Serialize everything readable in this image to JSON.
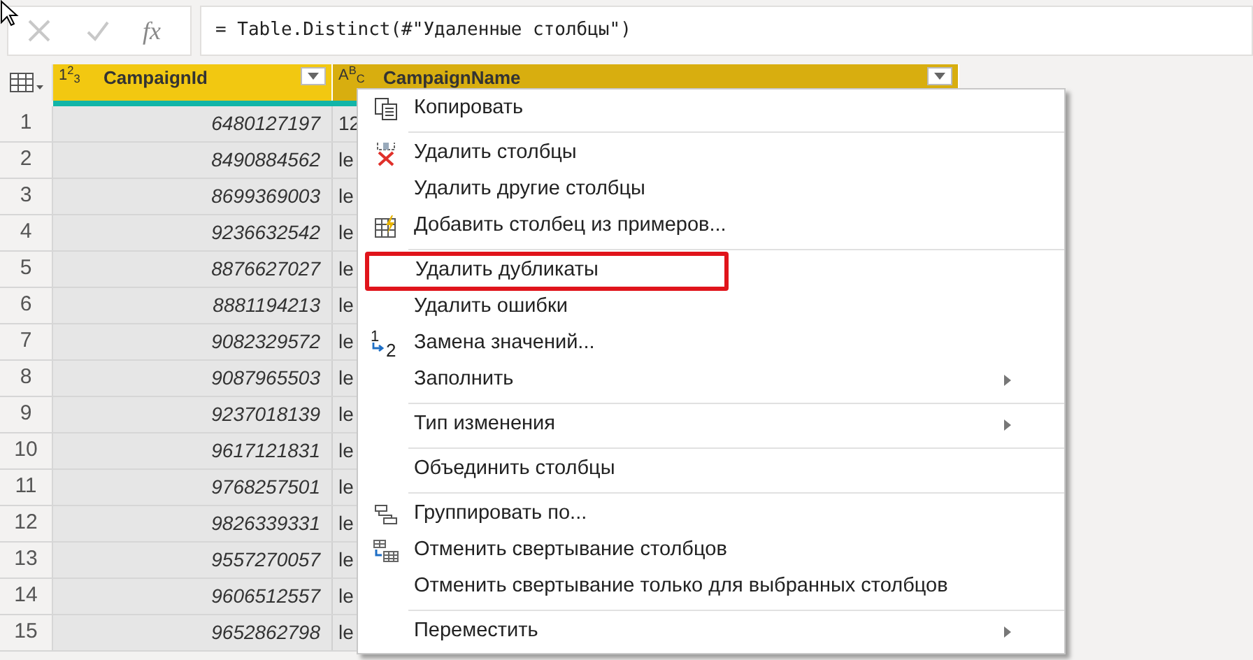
{
  "formula_bar": {
    "fx": "fx",
    "formula": "= Table.Distinct(#\"Удаленные столбцы\")"
  },
  "table": {
    "columns": [
      {
        "type_label": "1$^{2}$$_{3}$",
        "name": "CampaignId",
        "selected": false
      },
      {
        "type_label": "A$^{B}$$_{C}$",
        "name": "CampaignName",
        "selected": true
      }
    ],
    "rows": [
      {
        "n": "1",
        "id": "6480127197",
        "name": "12"
      },
      {
        "n": "2",
        "id": "8490884562",
        "name": "le"
      },
      {
        "n": "3",
        "id": "8699369003",
        "name": "le"
      },
      {
        "n": "4",
        "id": "9236632542",
        "name": "le"
      },
      {
        "n": "5",
        "id": "8876627027",
        "name": "le"
      },
      {
        "n": "6",
        "id": "8881194213",
        "name": "le"
      },
      {
        "n": "7",
        "id": "9082329572",
        "name": "le"
      },
      {
        "n": "8",
        "id": "9087965503",
        "name": "le"
      },
      {
        "n": "9",
        "id": "9237018139",
        "name": "le"
      },
      {
        "n": "10",
        "id": "9617121831",
        "name": "le"
      },
      {
        "n": "11",
        "id": "9768257501",
        "name": "le"
      },
      {
        "n": "12",
        "id": "9826339331",
        "name": "le"
      },
      {
        "n": "13",
        "id": "9557270057",
        "name": "le"
      },
      {
        "n": "14",
        "id": "9606512557",
        "name": "le"
      },
      {
        "n": "15",
        "id": "9652862798",
        "name": "le"
      }
    ]
  },
  "context_menu": {
    "items": [
      {
        "kind": "item",
        "label": "Копировать",
        "submenu": false,
        "highlighted": false
      },
      {
        "kind": "separator"
      },
      {
        "kind": "item",
        "label": "Удалить столбцы",
        "submenu": false,
        "highlighted": false
      },
      {
        "kind": "item",
        "label": "Удалить другие столбцы",
        "submenu": false,
        "highlighted": false
      },
      {
        "kind": "item",
        "label": "Добавить столбец из примеров...",
        "submenu": false,
        "highlighted": false
      },
      {
        "kind": "separator"
      },
      {
        "kind": "item",
        "label": "Удалить дубликаты",
        "submenu": false,
        "highlighted": true
      },
      {
        "kind": "item",
        "label": "Удалить ошибки",
        "submenu": false,
        "highlighted": false
      },
      {
        "kind": "item",
        "label": "Замена значений...",
        "icon_digits": [
          "1",
          "2"
        ],
        "submenu": false,
        "highlighted": false
      },
      {
        "kind": "item",
        "label": "Заполнить",
        "submenu": true,
        "highlighted": false
      },
      {
        "kind": "separator"
      },
      {
        "kind": "item",
        "label": "Тип изменения",
        "submenu": true,
        "highlighted": false
      },
      {
        "kind": "separator"
      },
      {
        "kind": "item",
        "label": "Объединить столбцы",
        "submenu": false,
        "highlighted": false
      },
      {
        "kind": "separator"
      },
      {
        "kind": "item",
        "label": "Группировать по...",
        "submenu": false,
        "highlighted": false
      },
      {
        "kind": "item",
        "label": "Отменить свертывание столбцов",
        "submenu": false,
        "highlighted": false
      },
      {
        "kind": "item",
        "label": "Отменить свертывание только для выбранных столбцов",
        "submenu": false,
        "highlighted": false
      },
      {
        "kind": "separator"
      },
      {
        "kind": "item",
        "label": "Переместить",
        "submenu": true,
        "highlighted": false
      }
    ]
  }
}
